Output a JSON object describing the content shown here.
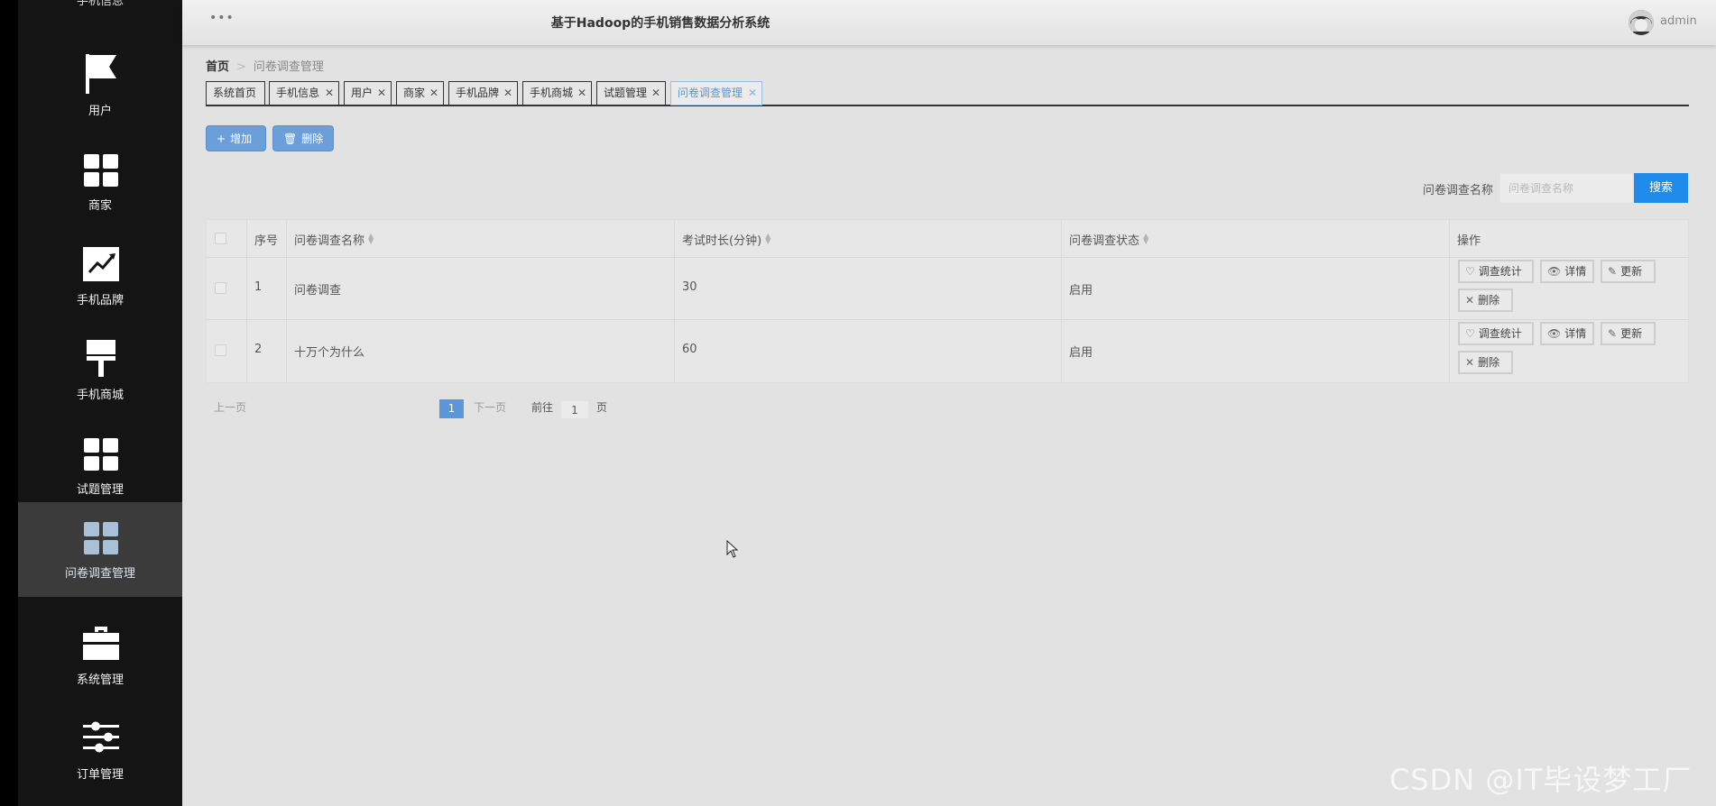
{
  "app": {
    "title": "基于Hadoop的手机销售数据分析系统",
    "user": "admin"
  },
  "sidebar": {
    "cut_label": "手机信息",
    "items": [
      {
        "label": "用户",
        "icon": "flag-icon"
      },
      {
        "label": "商家",
        "icon": "grid-icon"
      },
      {
        "label": "手机品牌",
        "icon": "chart-line-icon"
      },
      {
        "label": "手机商城",
        "icon": "brush-icon"
      },
      {
        "label": "试题管理",
        "icon": "grid-icon"
      },
      {
        "label": "问卷调查管理",
        "icon": "grid-icon",
        "active": true
      },
      {
        "label": "系统管理",
        "icon": "briefcase-icon"
      },
      {
        "label": "订单管理",
        "icon": "sliders-icon"
      }
    ]
  },
  "breadcrumb": {
    "home": "首页",
    "current": "问卷调查管理"
  },
  "tabs": [
    {
      "label": "系统首页",
      "closable": false
    },
    {
      "label": "手机信息",
      "closable": true
    },
    {
      "label": "用户",
      "closable": true
    },
    {
      "label": "商家",
      "closable": true
    },
    {
      "label": "手机品牌",
      "closable": true
    },
    {
      "label": "手机商城",
      "closable": true
    },
    {
      "label": "试题管理",
      "closable": true
    },
    {
      "label": "问卷调查管理",
      "closable": true,
      "active": true
    }
  ],
  "toolbar": {
    "add_label": "增加",
    "delete_label": "删除"
  },
  "search": {
    "label": "问卷调查名称",
    "placeholder": "问卷调查名称",
    "button": "搜索"
  },
  "table": {
    "headers": {
      "index": "序号",
      "name": "问卷调查名称",
      "duration": "考试时长(分钟)",
      "status": "问卷调查状态",
      "actions": "操作"
    },
    "rows": [
      {
        "index": "1",
        "name": "问卷调查",
        "duration": "30",
        "status": "启用"
      },
      {
        "index": "2",
        "name": "十万个为什么",
        "duration": "60",
        "status": "启用"
      }
    ],
    "actions": {
      "stats": "调查统计",
      "detail": "详情",
      "update": "更新",
      "delete": "删除"
    }
  },
  "pagination": {
    "prev": "上一页",
    "next": "下一页",
    "current": "1",
    "goto_prefix": "前往",
    "goto_value": "1",
    "goto_suffix": "页"
  },
  "watermark": "CSDN @IT毕设梦工厂",
  "colors": {
    "primary": "#1f8ceb",
    "button_blue": "#6a9fda",
    "sidebar_bg": "#141414",
    "active_item": "#3b3b3b"
  }
}
